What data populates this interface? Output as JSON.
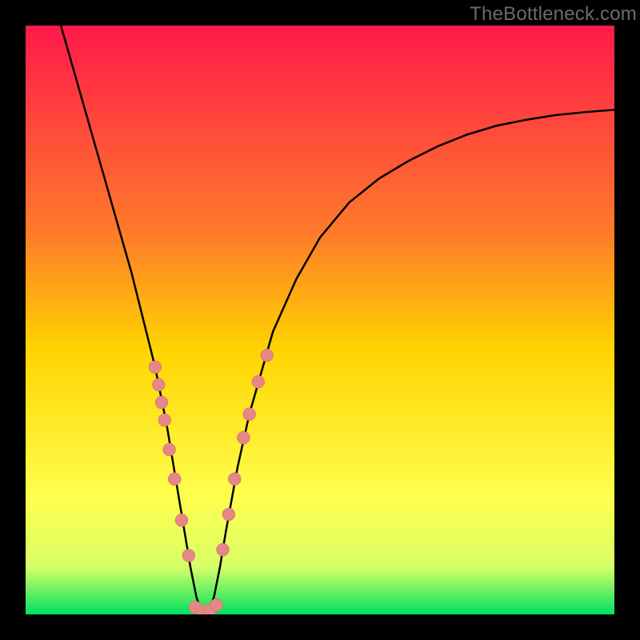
{
  "watermark": "TheBottleneck.com",
  "colors": {
    "black": "#000000",
    "curve": "#000000",
    "dot_fill": "#e68787",
    "dot_stroke": "#d06464",
    "gradient_top": "#ff1a4b",
    "gradient_mid1": "#ff7a2a",
    "gradient_mid2": "#ffd400",
    "gradient_yellow": "#ffff4d",
    "gradient_ygreen": "#d6ff66",
    "gradient_green": "#00e060"
  },
  "chart_data": {
    "type": "line",
    "title": "",
    "xlabel": "",
    "ylabel": "",
    "xlim": [
      0,
      100
    ],
    "ylim": [
      0,
      100
    ],
    "series": [
      {
        "name": "bottleneck-curve",
        "x": [
          6,
          8,
          10,
          12,
          14,
          16,
          18,
          20,
          22,
          24,
          25,
          26,
          27,
          28,
          29,
          30,
          31,
          32,
          33,
          34,
          36,
          38,
          42,
          46,
          50,
          55,
          60,
          65,
          70,
          75,
          80,
          85,
          90,
          95,
          100
        ],
        "y": [
          100,
          93,
          86,
          79,
          72,
          65,
          58,
          50,
          42,
          32,
          26,
          20,
          14,
          8,
          3,
          0,
          0,
          3,
          8,
          14,
          25,
          34,
          48,
          57,
          64,
          70,
          74,
          77,
          79.5,
          81.5,
          83,
          84,
          84.8,
          85.3,
          85.7
        ]
      }
    ],
    "dots_left": [
      {
        "x": 22.0,
        "y": 42.0
      },
      {
        "x": 22.6,
        "y": 39.0
      },
      {
        "x": 23.1,
        "y": 36.0
      },
      {
        "x": 23.6,
        "y": 33.0
      },
      {
        "x": 24.4,
        "y": 28.0
      },
      {
        "x": 25.3,
        "y": 23.0
      },
      {
        "x": 26.5,
        "y": 16.0
      },
      {
        "x": 27.7,
        "y": 10.0
      }
    ],
    "dots_right": [
      {
        "x": 33.5,
        "y": 11.0
      },
      {
        "x": 34.5,
        "y": 17.0
      },
      {
        "x": 35.5,
        "y": 23.0
      },
      {
        "x": 37.0,
        "y": 30.0
      },
      {
        "x": 38.0,
        "y": 34.0
      },
      {
        "x": 39.5,
        "y": 39.5
      },
      {
        "x": 41.0,
        "y": 44.0
      }
    ],
    "dots_bottom": [
      {
        "x": 28.8,
        "y": 1.2
      },
      {
        "x": 30.0,
        "y": 0.6
      },
      {
        "x": 31.2,
        "y": 0.6
      },
      {
        "x": 32.4,
        "y": 1.6
      }
    ]
  }
}
